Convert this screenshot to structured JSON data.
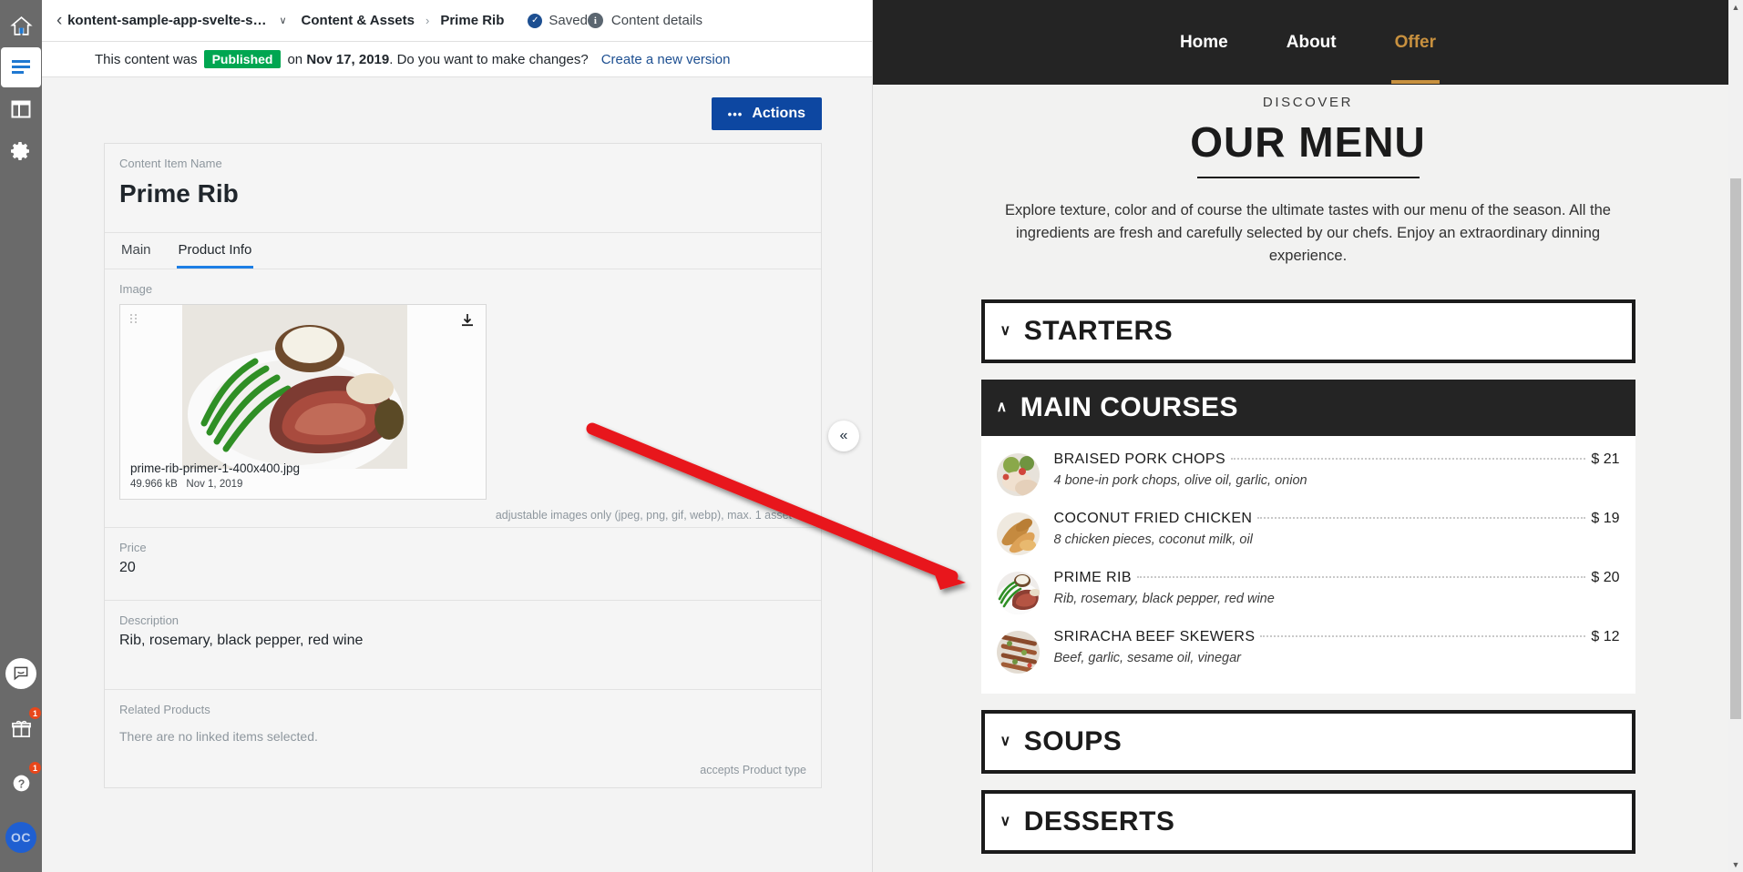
{
  "rail": {
    "icons": [
      {
        "name": "home-icon",
        "label": "Home"
      },
      {
        "name": "content-icon",
        "label": "Content & Assets"
      },
      {
        "name": "layout-icon",
        "label": "Content model"
      },
      {
        "name": "gear-icon",
        "label": "Project settings"
      }
    ],
    "bottom": [
      {
        "name": "chat-icon",
        "label": "Messenger",
        "badge": ""
      },
      {
        "name": "gift-icon",
        "label": "What's new",
        "badge": "1"
      },
      {
        "name": "help-icon",
        "label": "Help",
        "badge": "1"
      },
      {
        "name": "avatar",
        "label": "OC",
        "badge": ""
      }
    ]
  },
  "topbar": {
    "back": "‹",
    "project_name": "kontent-sample-app-svelte-s…",
    "caret": "∨",
    "breadcrumb_root": "Content & Assets",
    "breadcrumb_sep": "›",
    "breadcrumb_current": "Prime Rib",
    "saved_label": "Saved",
    "saved_check": "✓",
    "content_details": "Content details",
    "info_glyph": "i"
  },
  "publish_bar": {
    "prefix": "This content was",
    "status": "Published",
    "on": "on",
    "date": "Nov 17, 2019",
    "question": ". Do you want to make changes?",
    "link": "Create a new version"
  },
  "toolbar": {
    "actions_label": "Actions",
    "actions_dots": "•••"
  },
  "item": {
    "name_label": "Content Item Name",
    "name_value": "Prime Rib"
  },
  "tabs": [
    {
      "label": "Main",
      "active": false
    },
    {
      "label": "Product Info",
      "active": true
    }
  ],
  "fields": {
    "image": {
      "label": "Image",
      "asset_name": "prime-rib-primer-1-400x400.jpg",
      "asset_size": "49.966 kB",
      "asset_date": "Nov 1, 2019",
      "hint": "adjustable images only (jpeg, png, gif, webp), max. 1 asset",
      "download_icon": "download-icon",
      "drag_icon": "drag-handle-icon"
    },
    "price": {
      "label": "Price",
      "value": "20"
    },
    "description": {
      "label": "Description",
      "value": "Rib, rosemary, black pepper, red wine"
    },
    "related": {
      "label": "Related Products",
      "empty": "There are no linked items selected.",
      "accepts": "accepts Product type"
    }
  },
  "collapse_button": {
    "glyph": "«",
    "name": "collapse-preview-button"
  },
  "preview": {
    "nav": [
      {
        "label": "Home",
        "active": false
      },
      {
        "label": "About",
        "active": false
      },
      {
        "label": "Offer",
        "active": true
      }
    ],
    "eyebrow": "DISCOVER",
    "title": "OUR MENU",
    "intro": "Explore texture, color and of course the ultimate tastes with our menu of the season. All the ingredients are fresh and carefully selected by our chefs. Enjoy an extraordinary dinning experience.",
    "sections": [
      {
        "title": "STARTERS",
        "expanded": false,
        "chevron": "∨",
        "items": []
      },
      {
        "title": "MAIN COURSES",
        "expanded": true,
        "chevron": "∧",
        "items": [
          {
            "name": "BRAISED PORK CHOPS",
            "price": "$ 21",
            "desc": "4 bone-in pork chops, olive oil, garlic, onion",
            "thumb": "pork-chops-thumb"
          },
          {
            "name": "COCONUT FRIED CHICKEN",
            "price": "$ 19",
            "desc": "8 chicken pieces, coconut milk, oil",
            "thumb": "fried-chicken-thumb"
          },
          {
            "name": "PRIME RIB",
            "price": "$ 20",
            "desc": "Rib, rosemary, black pepper, red wine",
            "thumb": "prime-rib-thumb"
          },
          {
            "name": "SRIRACHA BEEF SKEWERS",
            "price": "$ 12",
            "desc": "Beef, garlic, sesame oil, vinegar",
            "thumb": "beef-skewers-thumb"
          }
        ]
      },
      {
        "title": "SOUPS",
        "expanded": false,
        "chevron": "∨",
        "items": []
      },
      {
        "title": "DESSERTS",
        "expanded": false,
        "chevron": "∨",
        "items": []
      }
    ],
    "scrollbar": {
      "up_arrow": "▲",
      "down_arrow": "▼"
    }
  },
  "colors": {
    "accent_blue": "#0d47a1",
    "published_green": "#00a651",
    "gold": "#c8913f",
    "dark": "#242424",
    "annotation_red": "#e8191b"
  }
}
